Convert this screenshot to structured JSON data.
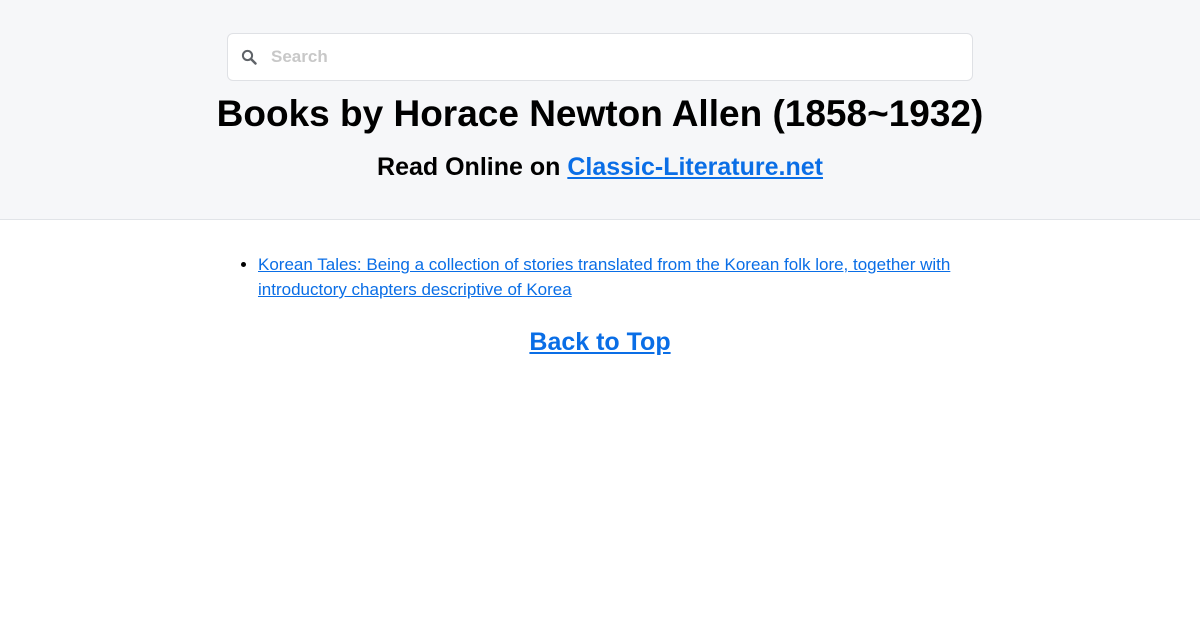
{
  "search": {
    "placeholder": "Search",
    "icon": "search-icon"
  },
  "header": {
    "title": "Books by Horace Newton Allen (1858~1932)",
    "subtitle_prefix": "Read Online on ",
    "site_link": "Classic-Literature.net"
  },
  "books": [
    {
      "title": "Korean Tales: Being a collection of stories translated from the Korean folk lore, together with introductory chapters descriptive of Korea"
    }
  ],
  "footer": {
    "back_to_top": "Back to Top"
  },
  "colors": {
    "link": "#0a6ee6",
    "header_bg": "#f6f7f9"
  }
}
